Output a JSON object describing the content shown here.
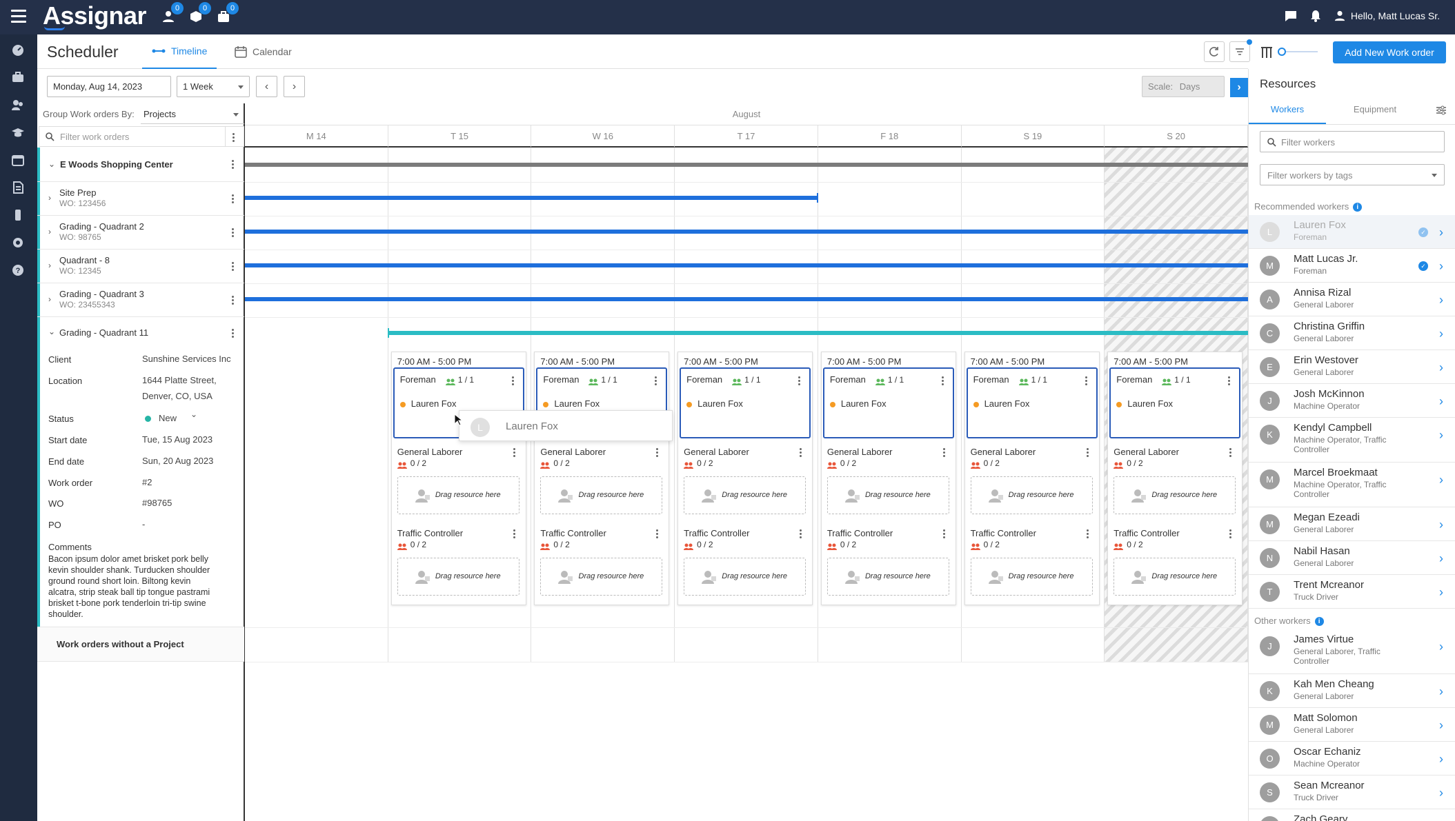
{
  "app": {
    "logo": "Assignar",
    "badges": [
      "0",
      "0",
      "0"
    ],
    "greeting": "Hello, Matt Lucas Sr."
  },
  "header": {
    "title": "Scheduler",
    "tabs": [
      {
        "label": "Timeline",
        "icon": "timeline-icon",
        "active": true
      },
      {
        "label": "Calendar",
        "icon": "calendar-icon",
        "active": false
      }
    ],
    "add_button": "Add New Work order"
  },
  "controls": {
    "date": "Monday, Aug 14, 2023",
    "range": "1 Week",
    "scale_label": "Scale:",
    "scale_value": "Days"
  },
  "wo_panel": {
    "group_by_label": "Group Work orders By:",
    "group_by_value": "Projects",
    "filter_placeholder": "Filter work orders",
    "project": "E Woods Shopping Center",
    "work_orders": [
      {
        "name": "Site Prep",
        "wo": "WO: 123456"
      },
      {
        "name": "Grading - Quadrant 2",
        "wo": "WO: 98765"
      },
      {
        "name": "Quadrant - 8",
        "wo": "WO: 12345"
      },
      {
        "name": "Grading - Quadrant 3",
        "wo": "WO: 23455343"
      }
    ],
    "expanded": {
      "name": "Grading - Quadrant 11",
      "client_label": "Client",
      "client": "Sunshine Services Inc",
      "location_label": "Location",
      "location_1": "1644 Platte Street,",
      "location_2": "Denver, CO, USA",
      "status_label": "Status",
      "status": "New",
      "start_label": "Start date",
      "start": "Tue, 15 Aug 2023",
      "end_label": "End date",
      "end": "Sun, 20 Aug 2023",
      "wo_num_label": "Work order",
      "wo_num": "#2",
      "wo_label": "WO",
      "wo": "#98765",
      "po_label": "PO",
      "po": "-",
      "comments_label": "Comments",
      "comments_lines": [
        "Bacon ipsum dolor amet brisket pork belly",
        "kevin shoulder shank. Turducken shoulder",
        "ground round short loin. Biltong kevin",
        "alcatra, strip steak ball tip tongue pastrami",
        "brisket t-bone pork tenderloin tri-tip swine",
        "shoulder."
      ]
    },
    "no_project": "Work orders without a Project"
  },
  "timeline": {
    "month": "August",
    "days": [
      "M 14",
      "T 15",
      "W 16",
      "T 17",
      "F 18",
      "S 19",
      "S 20"
    ],
    "weekend_days": [
      6
    ],
    "shift": "7:00 AM - 5:00 PM",
    "roles": {
      "foreman": "Foreman",
      "foreman_count": "1 / 1",
      "foreman_assignee": "Lauren Fox",
      "laborer": "General Laborer",
      "laborer_count": "0 / 2",
      "traffic": "Traffic Controller",
      "traffic_count": "0 / 2",
      "drop": "Drag resource here"
    },
    "drag_ghost": {
      "initial": "L",
      "name": "Lauren Fox"
    }
  },
  "resources": {
    "title": "Resources",
    "tabs": [
      "Workers",
      "Equipment"
    ],
    "filter_placeholder": "Filter workers",
    "tags_placeholder": "Filter workers by tags",
    "recommended_label": "Recommended workers",
    "recommended": [
      {
        "initial": "L",
        "name": "Lauren Fox",
        "role": "Foreman",
        "checked": true,
        "dim": true
      },
      {
        "initial": "M",
        "name": "Matt Lucas Jr.",
        "role": "Foreman",
        "checked": true
      },
      {
        "initial": "A",
        "name": "Annisa Rizal",
        "role": "General Laborer"
      },
      {
        "initial": "C",
        "name": "Christina Griffin",
        "role": "General Laborer"
      },
      {
        "initial": "E",
        "name": "Erin Westover",
        "role": "General Laborer"
      },
      {
        "initial": "J",
        "name": "Josh McKinnon",
        "role": "Machine Operator"
      },
      {
        "initial": "K",
        "name": "Kendyl Campbell",
        "role": "Machine Operator, Traffic Controller"
      },
      {
        "initial": "M",
        "name": "Marcel Broekmaat",
        "role": "Machine Operator, Traffic Controller"
      },
      {
        "initial": "M",
        "name": "Megan Ezeadi",
        "role": "General Laborer"
      },
      {
        "initial": "N",
        "name": "Nabil Hasan",
        "role": "General Laborer"
      },
      {
        "initial": "T",
        "name": "Trent Mcreanor",
        "role": "Truck Driver"
      }
    ],
    "other_label": "Other workers",
    "other": [
      {
        "initial": "J",
        "name": "James Virtue",
        "role": "General Laborer, Traffic Controller"
      },
      {
        "initial": "K",
        "name": "Kah Men Cheang",
        "role": "General Laborer"
      },
      {
        "initial": "M",
        "name": "Matt Solomon",
        "role": "General Laborer"
      },
      {
        "initial": "O",
        "name": "Oscar Echaniz",
        "role": "Machine Operator"
      },
      {
        "initial": "S",
        "name": "Sean Mcreanor",
        "role": "Truck Driver"
      },
      {
        "initial": "Z",
        "name": "Zach Geary",
        "role": ""
      }
    ]
  },
  "colors": {
    "topbar": "#243049",
    "accent": "#1e88e5",
    "bar_blue": "#1e6fdc",
    "bar_teal": "#2bbcc4",
    "bar_gray": "#7b7b7b",
    "status_new": "#26b5a6",
    "assignee_dot": "#f59b23"
  }
}
